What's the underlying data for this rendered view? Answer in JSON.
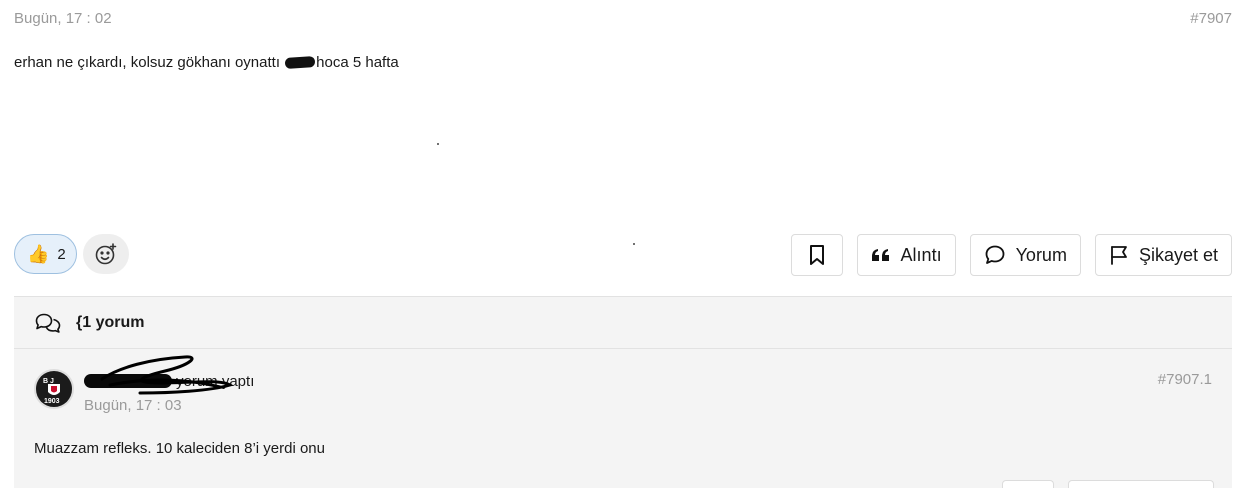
{
  "post": {
    "date": "Bugün, 17 : 02",
    "id": "#7907",
    "text_before": "erhan ne çıkardı, kolsuz gökhanı oynattı",
    "text_after": "hoca 5 hafta"
  },
  "reactions": {
    "like_count": "2",
    "like_emoji": "👍"
  },
  "actions": {
    "quote_label": "Alıntı",
    "comment_label": "Yorum",
    "report_label": "Şikayet et"
  },
  "comments": {
    "count_label": "{1 yorum",
    "items": [
      {
        "author_suffix": "yorum yaptı",
        "date": "Bugün, 17 : 03",
        "id": "#7907.1",
        "text": "Muazzam refleks. 10 kaleciden 8’i yerdi onu"
      }
    ]
  },
  "colors": {
    "muted_text": "#9a9a9a",
    "reaction_bg": "#e6f0fa",
    "reaction_border": "#9ec0e0",
    "panel_bg": "#f4f4f4"
  },
  "icons": [
    "bookmark-icon",
    "quote-icon",
    "comment-bubble-icon",
    "flag-icon",
    "add-emoji-icon",
    "comments-icon",
    "thumbs-up-icon"
  ]
}
